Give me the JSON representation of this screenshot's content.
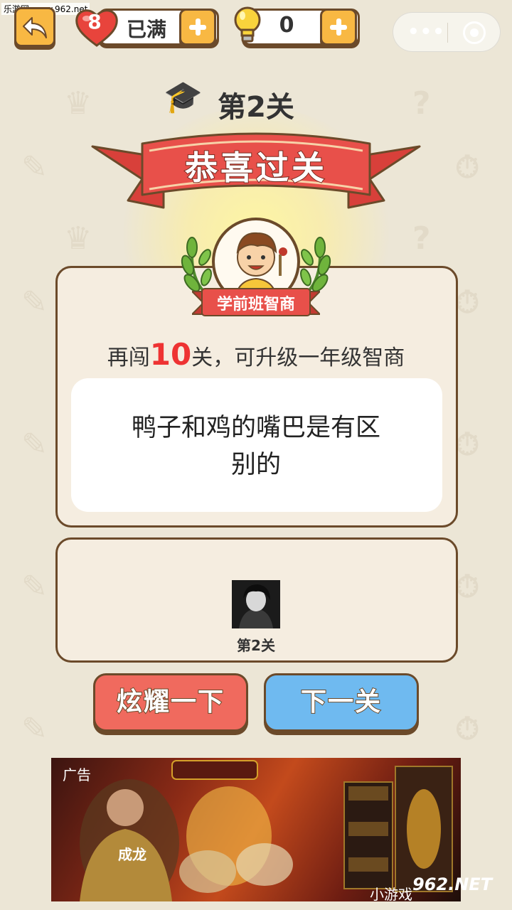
{
  "watermark": "乐游网 www.962.net",
  "header": {
    "lives_count": "8",
    "lives_status": "已满",
    "hint_count": "0"
  },
  "level": {
    "title": "第2关",
    "banner_text": "恭喜过关"
  },
  "rank": {
    "badge_text": "学前班智商",
    "upgrade_prefix": "再闯",
    "upgrade_number": "10",
    "upgrade_suffix": "关，可升级一年级智商"
  },
  "answer": {
    "line1": "鸭子和鸡的嘴巴是有区",
    "line2": "别的"
  },
  "share": {
    "label": "第2关"
  },
  "buttons": {
    "show_off": "炫耀一下",
    "next_level": "下一关"
  },
  "ad": {
    "label": "广告",
    "footer": "小游戏",
    "logo": "962.NET",
    "name": "成龙"
  },
  "colors": {
    "background": "#ece6d6",
    "ribbon_red": "#e0483c",
    "button_red": "#f06a5e",
    "button_blue": "#6fbaf0",
    "accent_orange": "#f8b843",
    "highlight_red": "#e33"
  }
}
